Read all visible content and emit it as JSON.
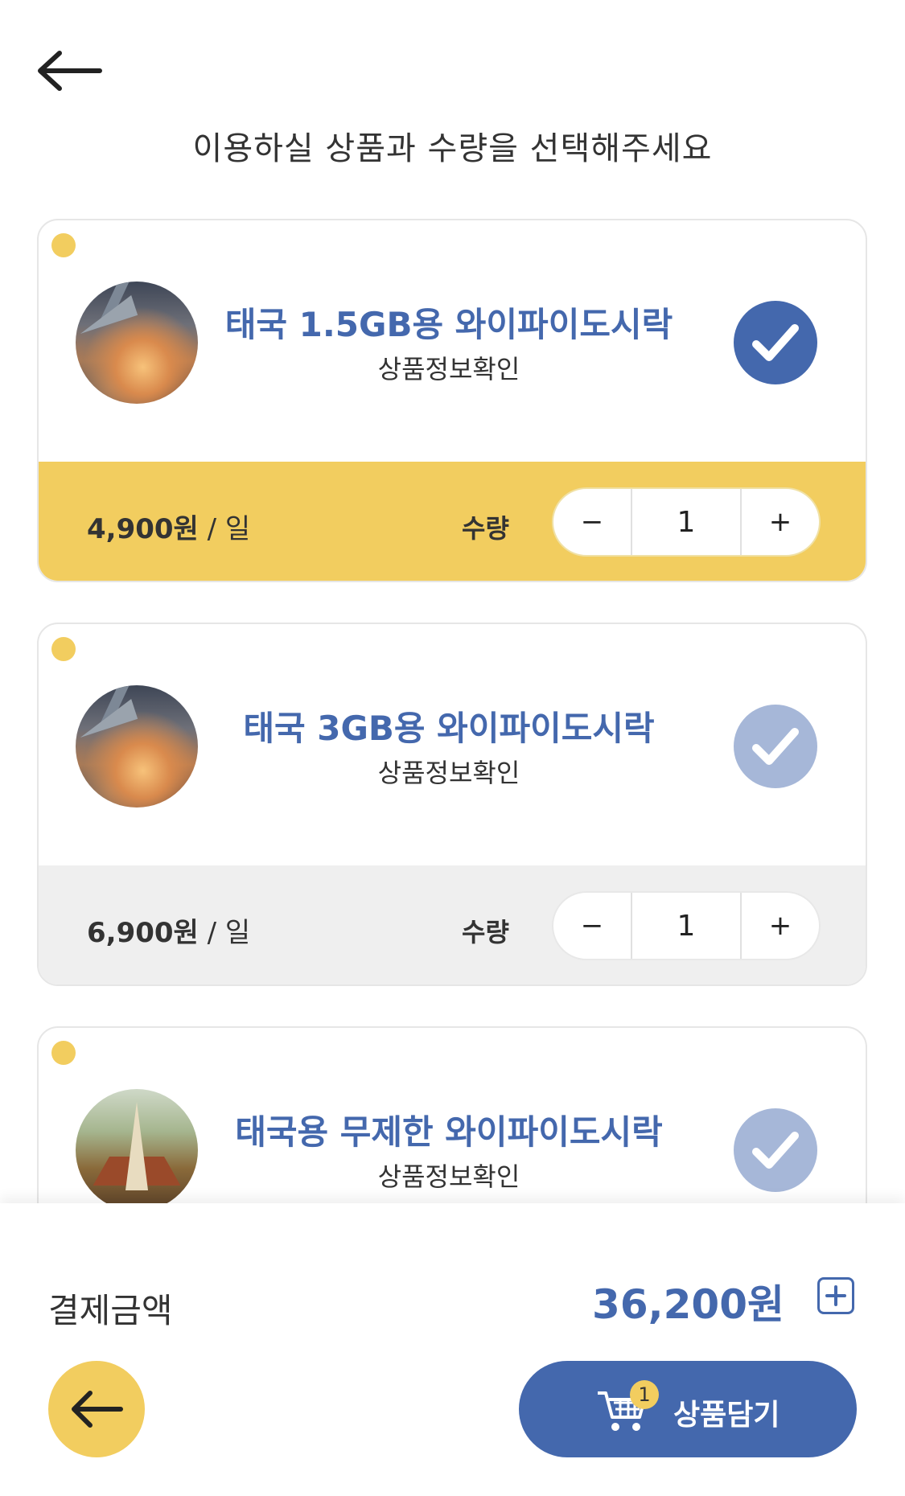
{
  "header": {
    "instruction": "이용하실 상품과 수량을 선택해주세요"
  },
  "products": [
    {
      "title": "태국 1.5GB용 와이파이도시락",
      "info_link": "상품정보확인",
      "price": "4,900원",
      "price_unit": " / 일",
      "qty_label": "수량",
      "quantity": "1",
      "minus": "−",
      "plus": "+",
      "selected": true
    },
    {
      "title": "태국 3GB용 와이파이도시락",
      "info_link": "상품정보확인",
      "price": "6,900원",
      "price_unit": " / 일",
      "qty_label": "수량",
      "quantity": "1",
      "minus": "−",
      "plus": "+",
      "selected": false
    },
    {
      "title": "태국용 무제한 와이파이도시락",
      "info_link": "상품정보확인",
      "selected": false
    }
  ],
  "footer": {
    "pay_label": "결제금액",
    "pay_amount": "36,200원",
    "cart_badge": "1",
    "cart_label": "상품담기"
  },
  "colors": {
    "accent": "#4468ad",
    "accent_light": "#a6b7d8",
    "yellow": "#f2cd5f",
    "gray_bg": "#efefef"
  },
  "icons": [
    "back-arrow-icon",
    "check-icon",
    "plus-square-icon",
    "cart-icon"
  ]
}
